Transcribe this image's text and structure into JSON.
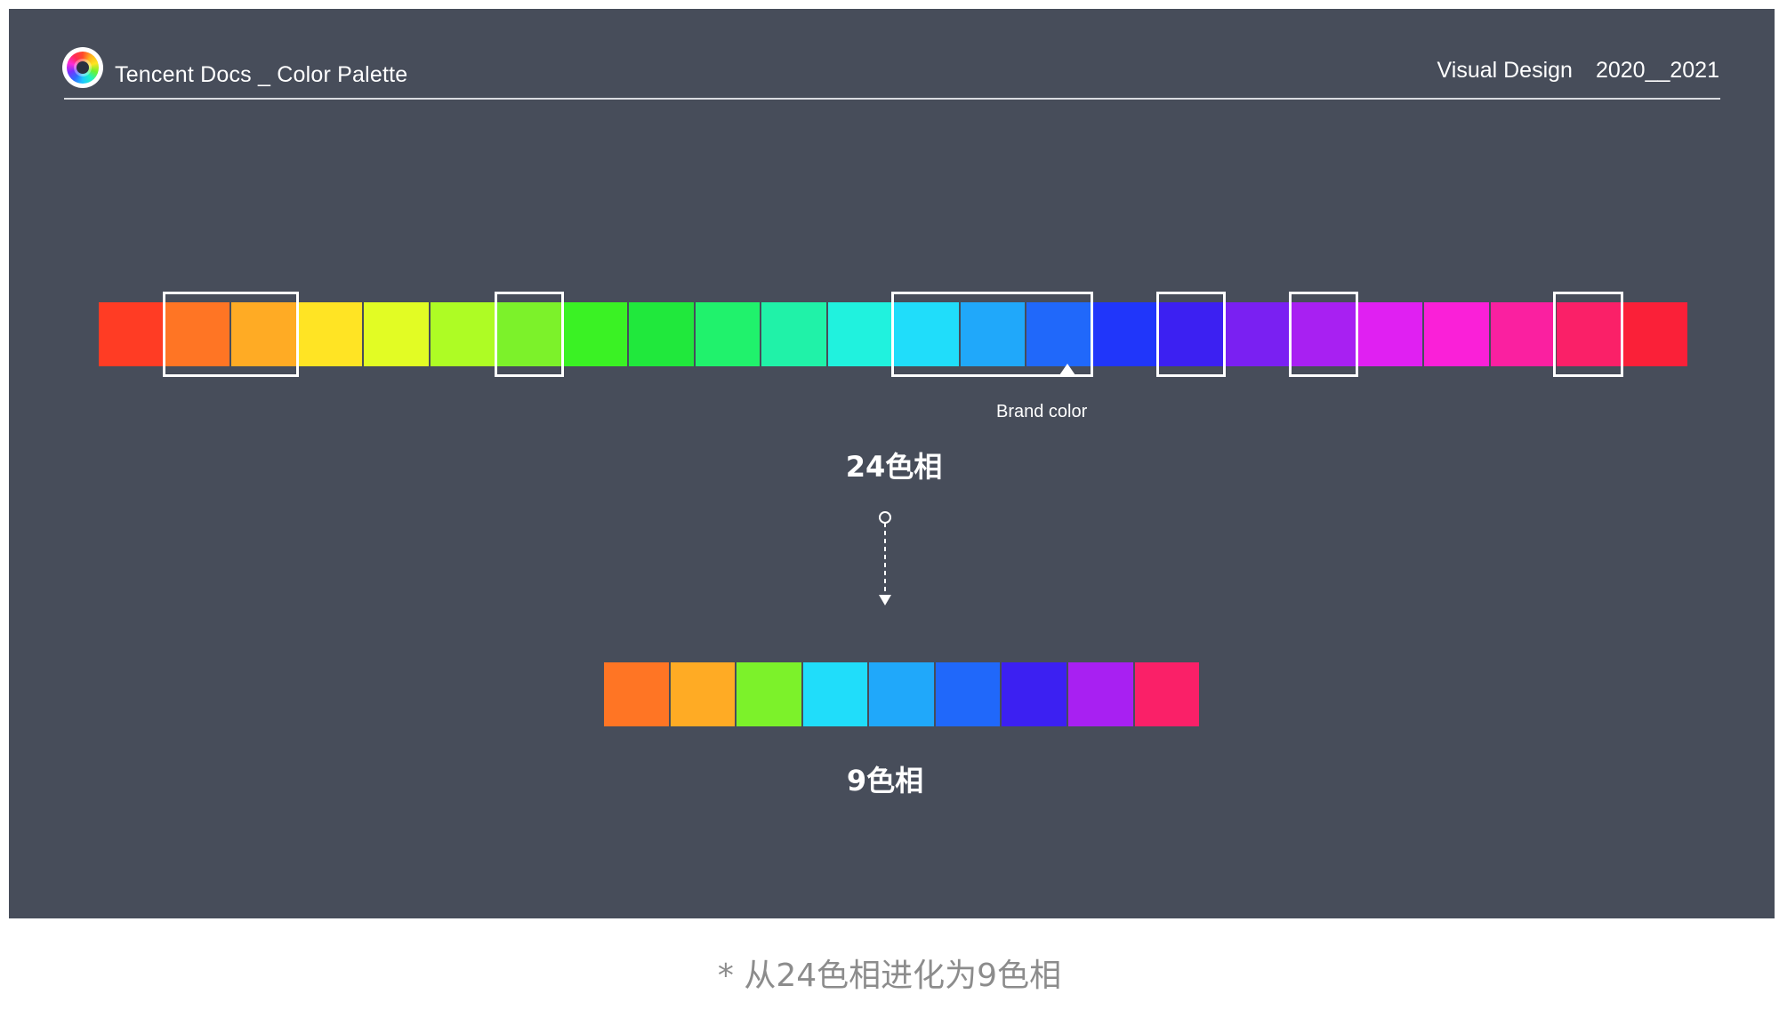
{
  "header": {
    "title": "Tencent Docs _ Color Palette",
    "section": "Visual Design",
    "years": "2020__2021"
  },
  "palette24": {
    "label": "24色相",
    "colors": [
      "#ff3c24",
      "#ff7524",
      "#ffab24",
      "#ffe424",
      "#e2fc24",
      "#aefc24",
      "#7cf22a",
      "#3af224",
      "#20e83c",
      "#20f26c",
      "#20f2a8",
      "#20f2de",
      "#20ddfa",
      "#20a8fa",
      "#2068fa",
      "#2036fa",
      "#3c20f2",
      "#7a20f2",
      "#a820f2",
      "#e020f2",
      "#fa20d8",
      "#fa20a0",
      "#fa2068",
      "#fa2038"
    ],
    "selected_groups": [
      [
        1,
        2
      ],
      [
        6
      ],
      [
        12,
        13,
        14
      ],
      [
        16
      ],
      [
        18
      ],
      [
        22
      ]
    ],
    "brand_index": 14,
    "brand_label": "Brand color"
  },
  "palette9": {
    "label": "9色相",
    "colors": [
      "#ff7524",
      "#ffab24",
      "#7cf22a",
      "#20ddfa",
      "#20a8fa",
      "#2068fa",
      "#3c20f2",
      "#a820f2",
      "#fa2068"
    ]
  },
  "colors": {
    "slide_background": "#474d5a",
    "caption_text": "#8c8c8c"
  },
  "caption": "* 从24色相进化为9色相"
}
